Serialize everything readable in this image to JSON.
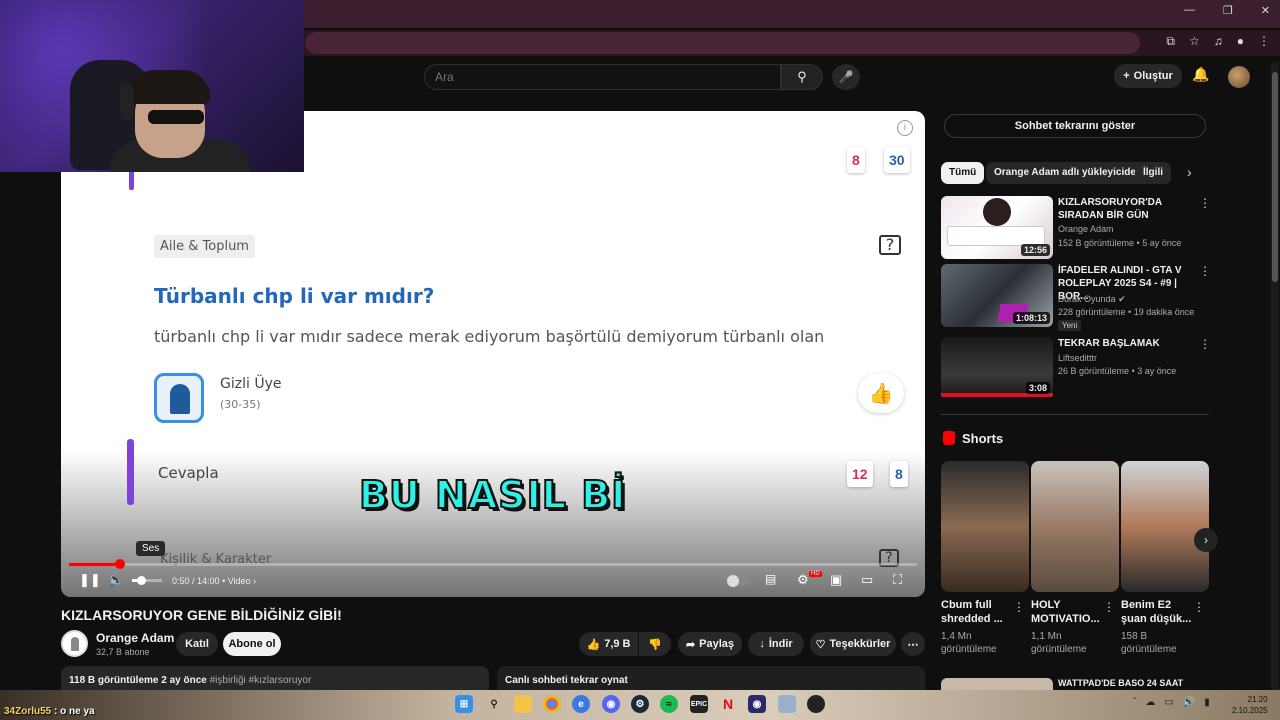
{
  "search": {
    "placeholder": "Ara"
  },
  "header": {
    "create_label": "Oluştur"
  },
  "video_content": {
    "category_1": "Aile & Toplum",
    "question_title": "Türbanlı chp li var mıdır?",
    "question_body": "türbanlı chp li var mıdır sadece merak ediyorum başörtülü demiyorum türbanlı olan",
    "user_name": "Gizli Üye",
    "user_age": "(30-35)",
    "reply_label": "Cevapla",
    "category_2": "Kişilik & Karakter",
    "top_count_red": "8",
    "top_count_blue": "30",
    "bottom_count_red": "12",
    "bottom_count_blue": "8",
    "caption": "BU NASIL Bİ"
  },
  "player": {
    "tooltip": "Ses",
    "time": "0:50 / 14:00",
    "chapter": "• Video",
    "progress_fraction": 0.06,
    "volume_fraction": 0.3
  },
  "video_meta": {
    "title": "KIZLARSORUYOR GENE BİLDİĞİNİZ GİBİ!",
    "channel_name": "Orange Adam",
    "subscribers": "32,7 B abone",
    "join_label": "Katıl",
    "subscribe_label": "Abone ol",
    "likes": "7,9 B",
    "share_label": "Paylaş",
    "download_label": "İndir",
    "thanks_label": "Teşekkürler",
    "views_date": "118 B görüntüleme  2 ay önce",
    "hashtags": "#işbirliği #kızlarsoruyor",
    "live_chat_label": "Canlı sohbeti tekrar oynat"
  },
  "sidebar": {
    "chat_replay_label": "Sohbet tekrarını göster",
    "chips": [
      "Tümü",
      "Orange Adam adlı yükleyiciden",
      "İlgili"
    ],
    "recommendations": [
      {
        "title": "KIZLARSORUYOR'DA SIRADAN BİR GÜN",
        "channel": "Orange Adam",
        "meta": "152 B görüntüleme • 5 ay önce",
        "duration": "12:56"
      },
      {
        "title": "İFADELER ALINDI - GTA V ROLEPLAY 2025 S4 - #9 | BOR...",
        "channel": "Burak Oyunda",
        "meta": "228 görüntüleme • 19 dakika önce",
        "duration": "1:08:13",
        "badge": "Yeni"
      },
      {
        "title": "TEKRAR BAŞLAMAK",
        "channel": "Liftseditttr",
        "meta": "26 B görüntüleme • 3 ay önce",
        "duration": "3:08"
      }
    ],
    "shorts_label": "Shorts",
    "shorts": [
      {
        "title": "Cbum full shredded ...",
        "views": "1,4 Mn görüntüleme"
      },
      {
        "title": "HOLY MOTIVATIO...",
        "views": "1,1 Mn görüntüleme"
      },
      {
        "title": "Benim E2 şuan düşük...",
        "views": "158 B görüntüleme"
      }
    ],
    "next_reco_title": "WATTPAD'DE BASO 24 SAAT"
  },
  "taskbar": {
    "chat_user": "34Zorlu55",
    "chat_text": ": o ne ya",
    "time": "21:20",
    "date": "2.10.2025"
  },
  "colors": {
    "accent_red": "#ff0000",
    "question_blue": "#2168b8",
    "caption_cyan": "#2ef0e4",
    "purple_bar": "#7a45d8"
  }
}
